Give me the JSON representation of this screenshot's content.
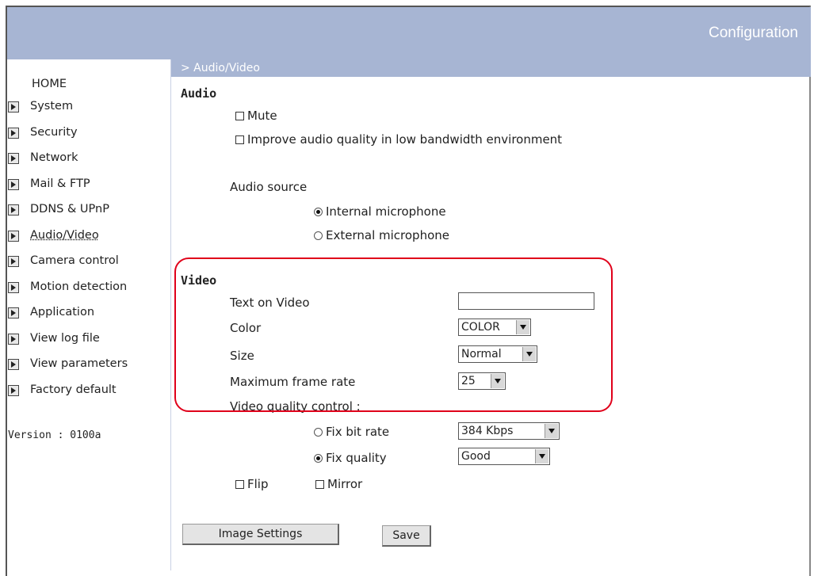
{
  "header": {
    "title": "Configuration"
  },
  "breadcrumb": "> Audio/Video",
  "sidebar": {
    "home": "HOME",
    "items": [
      {
        "label": "System"
      },
      {
        "label": "Security"
      },
      {
        "label": "Network"
      },
      {
        "label": "Mail & FTP"
      },
      {
        "label": "DDNS & UPnP"
      },
      {
        "label": "Audio/Video",
        "active": true
      },
      {
        "label": "Camera control"
      },
      {
        "label": "Motion detection"
      },
      {
        "label": "Application"
      },
      {
        "label": "View log file"
      },
      {
        "label": "View parameters"
      },
      {
        "label": "Factory default"
      }
    ],
    "version": "Version : 0100a"
  },
  "audio": {
    "heading": "Audio",
    "mute_label": "Mute",
    "mute_checked": false,
    "improve_label": "Improve audio quality in low bandwidth environment",
    "improve_checked": false,
    "source_label": "Audio source",
    "internal_label": "Internal microphone",
    "external_label": "External microphone",
    "selected_source": "Internal microphone"
  },
  "video": {
    "heading": "Video",
    "text_on_video_label": "Text on Video",
    "text_on_video_value": "",
    "color_label": "Color",
    "color_value": "COLOR",
    "size_label": "Size",
    "size_value": "Normal",
    "frame_rate_label": "Maximum frame rate",
    "frame_rate_value": "25",
    "quality_control_label": "Video quality control :",
    "fix_bit_rate_label": "Fix bit rate",
    "bit_rate_value": "384 Kbps",
    "fix_quality_label": "Fix quality",
    "quality_value": "Good",
    "selected_mode": "Fix quality",
    "flip_label": "Flip",
    "mirror_label": "Mirror"
  },
  "buttons": {
    "image_settings": "Image Settings",
    "save": "Save"
  },
  "colors": {
    "header_bg": "#a7b5d3",
    "highlight_border": "#e0001a"
  }
}
